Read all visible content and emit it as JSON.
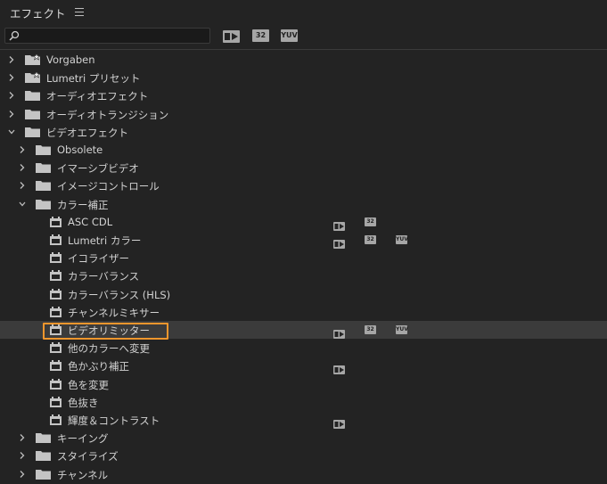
{
  "panel": {
    "title": "エフェクト",
    "search_value": ""
  },
  "toolbar_badges": {
    "accelerated": "GPU",
    "bit32": "32",
    "yuv": "YUV"
  },
  "tree": [
    {
      "label": "Vorgaben",
      "type": "preset-folder",
      "level": 0,
      "expanded": false
    },
    {
      "label": "Lumetri プリセット",
      "type": "preset-folder",
      "level": 0,
      "expanded": false
    },
    {
      "label": "オーディオエフェクト",
      "type": "folder",
      "level": 0,
      "expanded": false
    },
    {
      "label": "オーディオトランジション",
      "type": "folder",
      "level": 0,
      "expanded": false
    },
    {
      "label": "ビデオエフェクト",
      "type": "folder",
      "level": 0,
      "expanded": true
    },
    {
      "label": "Obsolete",
      "type": "folder",
      "level": 1,
      "expanded": false
    },
    {
      "label": "イマーシブビデオ",
      "type": "folder",
      "level": 1,
      "expanded": false
    },
    {
      "label": "イメージコントロール",
      "type": "folder",
      "level": 1,
      "expanded": false
    },
    {
      "label": "カラー補正",
      "type": "folder",
      "level": 1,
      "expanded": true
    },
    {
      "label": "ASC CDL",
      "type": "effect",
      "level": 2,
      "badges": [
        true,
        true,
        false
      ]
    },
    {
      "label": "Lumetri カラー",
      "type": "effect",
      "level": 2,
      "badges": [
        true,
        true,
        true
      ]
    },
    {
      "label": "イコライザー",
      "type": "effect",
      "level": 2,
      "badges": [
        false,
        false,
        false
      ]
    },
    {
      "label": "カラーバランス",
      "type": "effect",
      "level": 2,
      "badges": [
        false,
        false,
        false
      ]
    },
    {
      "label": "カラーバランス (HLS)",
      "type": "effect",
      "level": 2,
      "badges": [
        false,
        false,
        false
      ]
    },
    {
      "label": "チャンネルミキサー",
      "type": "effect",
      "level": 2,
      "badges": [
        false,
        false,
        false
      ]
    },
    {
      "label": "ビデオリミッター",
      "type": "effect",
      "level": 2,
      "badges": [
        true,
        true,
        true
      ],
      "selected": true
    },
    {
      "label": "他のカラーへ変更",
      "type": "effect",
      "level": 2,
      "badges": [
        false,
        false,
        false
      ]
    },
    {
      "label": "色かぶり補正",
      "type": "effect",
      "level": 2,
      "badges": [
        true,
        false,
        false
      ]
    },
    {
      "label": "色を変更",
      "type": "effect",
      "level": 2,
      "badges": [
        false,
        false,
        false
      ]
    },
    {
      "label": "色抜き",
      "type": "effect",
      "level": 2,
      "badges": [
        false,
        false,
        false
      ]
    },
    {
      "label": "輝度＆コントラスト",
      "type": "effect",
      "level": 2,
      "badges": [
        true,
        false,
        false
      ]
    },
    {
      "label": "キーイング",
      "type": "folder",
      "level": 1,
      "expanded": false
    },
    {
      "label": "スタイライズ",
      "type": "folder",
      "level": 1,
      "expanded": false
    },
    {
      "label": "チャンネル",
      "type": "folder",
      "level": 1,
      "expanded": false
    }
  ],
  "colors": {
    "background": "#232323",
    "selected_row": "#3b3b3b",
    "highlight": "#f0962d"
  }
}
